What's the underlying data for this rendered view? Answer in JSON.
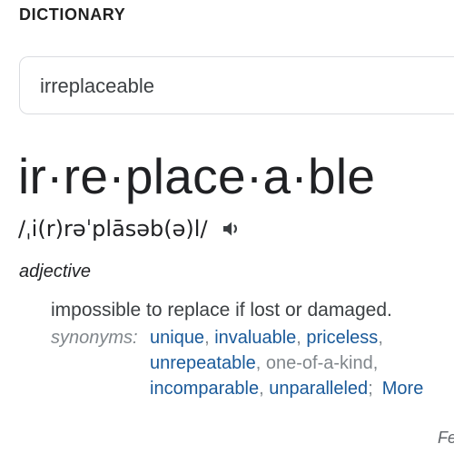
{
  "section": {
    "title": "DICTIONARY"
  },
  "search": {
    "value": "irreplaceable"
  },
  "entry": {
    "headword": "ir·re·place·a·ble",
    "pronunciation": "/ˌi(r)rəˈplāsəb(ə)l/",
    "part_of_speech": "adjective",
    "definition": "impossible to replace if lost or damaged.",
    "synonyms_label": "synonyms:",
    "synonyms": [
      {
        "text": "unique",
        "link": true
      },
      {
        "text": "invaluable",
        "link": true
      },
      {
        "text": "priceless",
        "link": true
      },
      {
        "text": "unrepeatable",
        "link": true
      },
      {
        "text": "one-of-a-kind",
        "link": false
      },
      {
        "text": "incomparable",
        "link": true
      },
      {
        "text": "unparalleled",
        "link": true
      }
    ],
    "more_label": "More"
  },
  "footer": {
    "partial_text": "Fe"
  },
  "icons": {
    "speaker": "speaker-icon"
  },
  "colors": {
    "link": "#1a5a9a",
    "muted": "#80868b",
    "text": "#202124"
  }
}
